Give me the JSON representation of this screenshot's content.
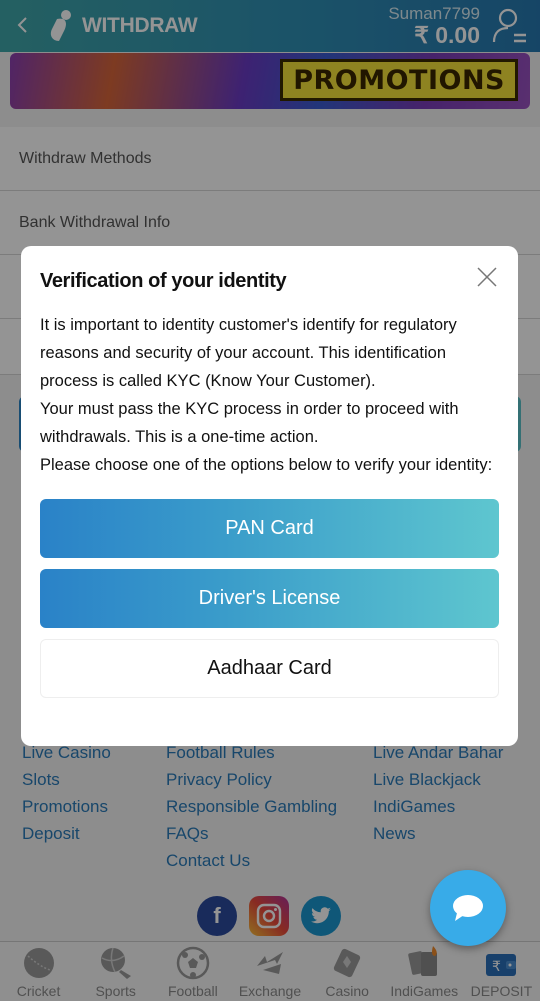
{
  "header": {
    "title": "WITHDRAW",
    "username": "Suman7799",
    "balance": "₹ 0.00",
    "colors": {
      "gradient_start": "#3fa6a9",
      "gradient_end": "#2778b0"
    }
  },
  "banner": {
    "label": "PROMOTIONS"
  },
  "background_list": {
    "items": [
      {
        "label": "Withdraw Methods"
      },
      {
        "label": "Bank Withdrawal Info"
      }
    ]
  },
  "modal": {
    "title": "Verification of your identity",
    "paragraph_1": "It is important to identity customer's identify for regulatory reasons and security of your account. This identification process is called KYC (Know Your Customer).",
    "paragraph_2": "Your must pass the KYC process in order to proceed with withdrawals. This is a one-time action.",
    "paragraph_3": "Please choose one of the options below to verify your identity:",
    "options": [
      {
        "label": "PAN Card",
        "style": "primary"
      },
      {
        "label": "Driver's License",
        "style": "primary"
      },
      {
        "label": "Aadhaar Card",
        "style": "secondary"
      }
    ]
  },
  "footer": {
    "col1": [
      "Live Casino",
      "Slots",
      "Promotions",
      "Deposit"
    ],
    "col2": [
      "Football Rules",
      "Privacy Policy",
      "Responsible Gambling",
      "FAQs",
      "Contact Us"
    ],
    "col3": [
      "Live Andar Bahar",
      "Live Blackjack",
      "IndiGames",
      "News"
    ],
    "social": [
      {
        "name": "facebook",
        "glyph": "f"
      },
      {
        "name": "instagram",
        "glyph": ""
      },
      {
        "name": "twitter",
        "glyph": ""
      }
    ]
  },
  "bottom_nav": {
    "items": [
      {
        "label": "Cricket",
        "icon": "cricket-ball-icon"
      },
      {
        "label": "Sports",
        "icon": "sports-icon"
      },
      {
        "label": "Football",
        "icon": "football-icon"
      },
      {
        "label": "Exchange",
        "icon": "exchange-icon"
      },
      {
        "label": "Casino",
        "icon": "casino-icon"
      },
      {
        "label": "IndiGames",
        "icon": "cards-icon"
      },
      {
        "label": "DEPOSIT",
        "icon": "wallet-icon"
      }
    ]
  }
}
